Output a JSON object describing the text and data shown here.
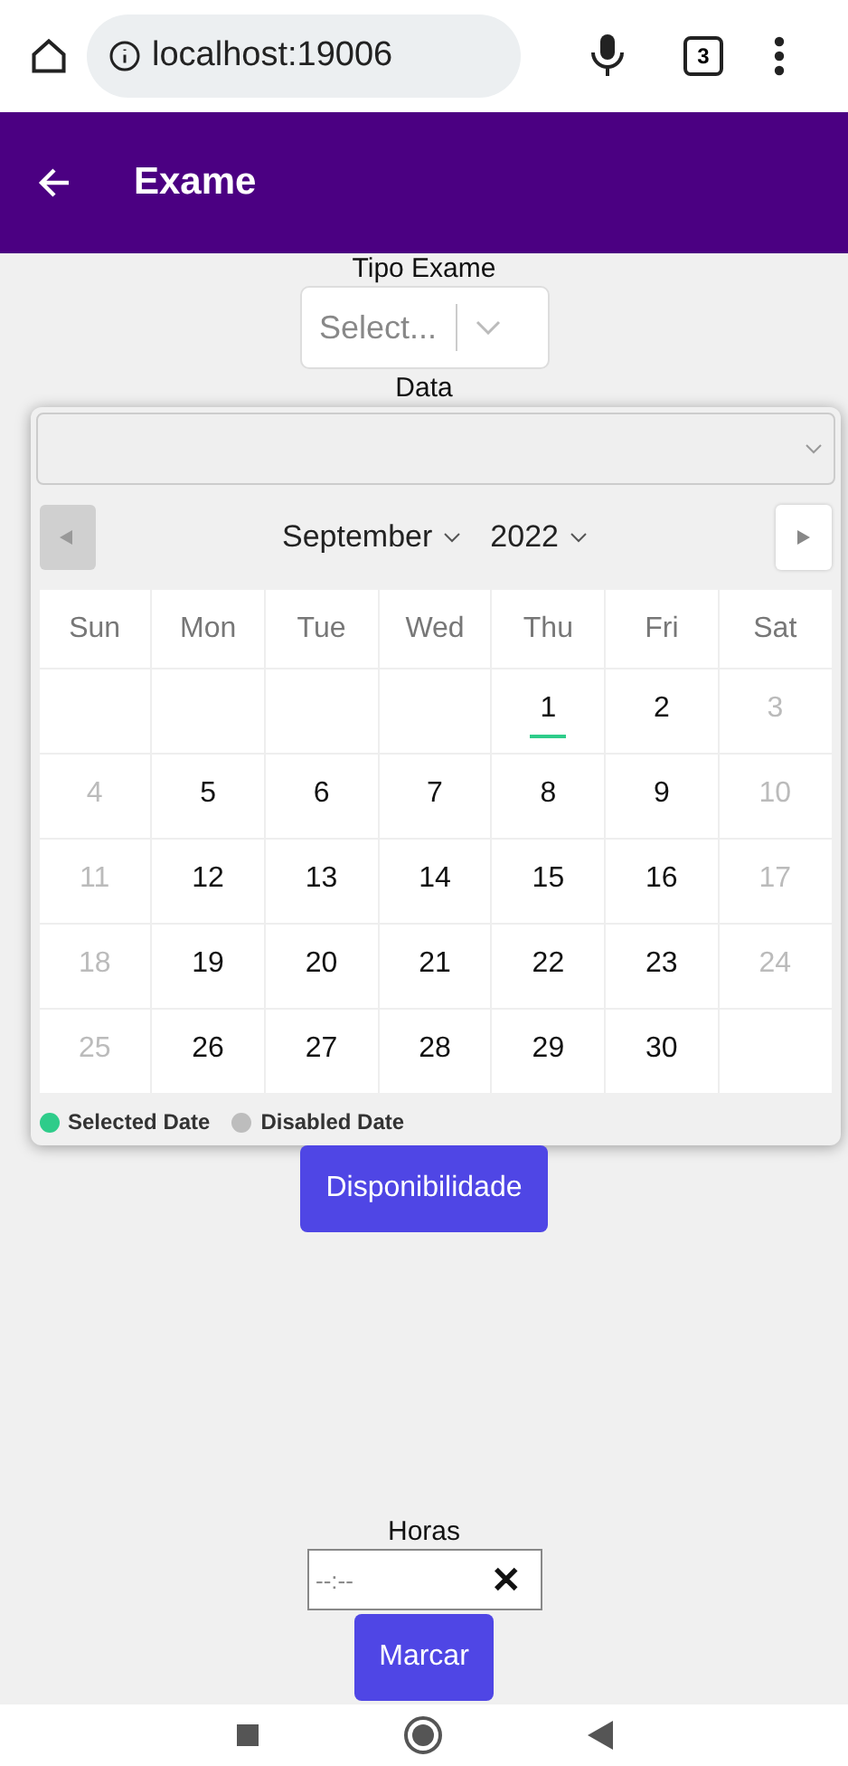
{
  "browser": {
    "url": "localhost:19006",
    "tab_count": "3"
  },
  "app_bar": {
    "title": "Exame"
  },
  "tipo_exame": {
    "label": "Tipo Exame",
    "placeholder": "Select..."
  },
  "data": {
    "label": "Data",
    "calendar": {
      "month": "September",
      "year": "2022",
      "prev_disabled": true,
      "next_disabled": false,
      "weekdays": [
        "Sun",
        "Mon",
        "Tue",
        "Wed",
        "Thu",
        "Fri",
        "Sat"
      ],
      "weeks": [
        [
          {
            "kind": "empty"
          },
          {
            "kind": "empty"
          },
          {
            "kind": "empty"
          },
          {
            "kind": "empty"
          },
          {
            "day": "1",
            "disabled": false,
            "selected": true
          },
          {
            "day": "2",
            "disabled": false,
            "selected": false
          },
          {
            "day": "3",
            "disabled": true,
            "selected": false
          }
        ],
        [
          {
            "day": "4",
            "disabled": true,
            "selected": false
          },
          {
            "day": "5",
            "disabled": false,
            "selected": false
          },
          {
            "day": "6",
            "disabled": false,
            "selected": false
          },
          {
            "day": "7",
            "disabled": false,
            "selected": false
          },
          {
            "day": "8",
            "disabled": false,
            "selected": false
          },
          {
            "day": "9",
            "disabled": false,
            "selected": false
          },
          {
            "day": "10",
            "disabled": true,
            "selected": false
          }
        ],
        [
          {
            "day": "11",
            "disabled": true,
            "selected": false
          },
          {
            "day": "12",
            "disabled": false,
            "selected": false
          },
          {
            "day": "13",
            "disabled": false,
            "selected": false
          },
          {
            "day": "14",
            "disabled": false,
            "selected": false
          },
          {
            "day": "15",
            "disabled": false,
            "selected": false
          },
          {
            "day": "16",
            "disabled": false,
            "selected": false
          },
          {
            "day": "17",
            "disabled": true,
            "selected": false
          }
        ],
        [
          {
            "day": "18",
            "disabled": true,
            "selected": false
          },
          {
            "day": "19",
            "disabled": false,
            "selected": false
          },
          {
            "day": "20",
            "disabled": false,
            "selected": false
          },
          {
            "day": "21",
            "disabled": false,
            "selected": false
          },
          {
            "day": "22",
            "disabled": false,
            "selected": false
          },
          {
            "day": "23",
            "disabled": false,
            "selected": false
          },
          {
            "day": "24",
            "disabled": true,
            "selected": false
          }
        ],
        [
          {
            "day": "25",
            "disabled": true,
            "selected": false
          },
          {
            "day": "26",
            "disabled": false,
            "selected": false
          },
          {
            "day": "27",
            "disabled": false,
            "selected": false
          },
          {
            "day": "28",
            "disabled": false,
            "selected": false
          },
          {
            "day": "29",
            "disabled": false,
            "selected": false
          },
          {
            "day": "30",
            "disabled": false,
            "selected": false
          },
          {
            "kind": "empty"
          }
        ]
      ],
      "legend": [
        {
          "label": "Selected Date",
          "color": "#2ecc8a"
        },
        {
          "label": "Disabled Date",
          "color": "#bdbdbd"
        }
      ]
    }
  },
  "availability_button": "Disponibilidade",
  "horas": {
    "label": "Horas",
    "placeholder": "--:--",
    "clear": "✕"
  },
  "submit_button": "Marcar"
}
